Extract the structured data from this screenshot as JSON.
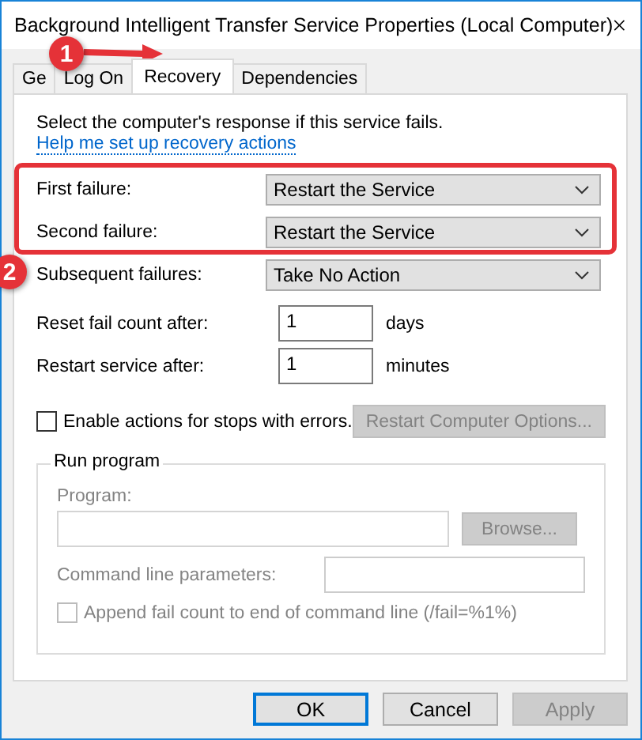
{
  "window": {
    "title": "Background Intelligent Transfer Service Properties (Local Computer)"
  },
  "tabs": [
    {
      "label": "Ge",
      "selected": false
    },
    {
      "label": "Log On",
      "selected": false
    },
    {
      "label": "Recovery",
      "selected": true
    },
    {
      "label": "Dependencies",
      "selected": false
    }
  ],
  "intro": {
    "text": "Select the computer's response if this service fails.",
    "link": "Help me set up recovery actions"
  },
  "failures": [
    {
      "label": "First failure:",
      "value": "Restart the Service"
    },
    {
      "label": "Second failure:",
      "value": "Restart the Service"
    },
    {
      "label": "Subsequent failures:",
      "value": "Take No Action"
    }
  ],
  "counters": [
    {
      "label": "Reset fail count after:",
      "value": "1",
      "unit": "days"
    },
    {
      "label": "Restart service after:",
      "value": "1",
      "unit": "minutes"
    }
  ],
  "stop_errors": {
    "label": "Enable actions for stops with errors.",
    "checked": false
  },
  "restart_options_button": {
    "label": "Restart Computer Options...",
    "disabled": true
  },
  "run_program": {
    "title": "Run program",
    "disabled": true,
    "program_label": "Program:",
    "browse_button": "Browse...",
    "params_label": "Command line parameters:",
    "append": {
      "label": "Append fail count to end of command line (/fail=%1%)",
      "checked": false
    }
  },
  "buttons": [
    {
      "label": "OK",
      "default": true,
      "disabled": false
    },
    {
      "label": "Cancel",
      "default": false,
      "disabled": false
    },
    {
      "label": "Apply",
      "default": false,
      "disabled": true
    }
  ],
  "annotations": [
    {
      "number": "1"
    },
    {
      "number": "2"
    }
  ]
}
